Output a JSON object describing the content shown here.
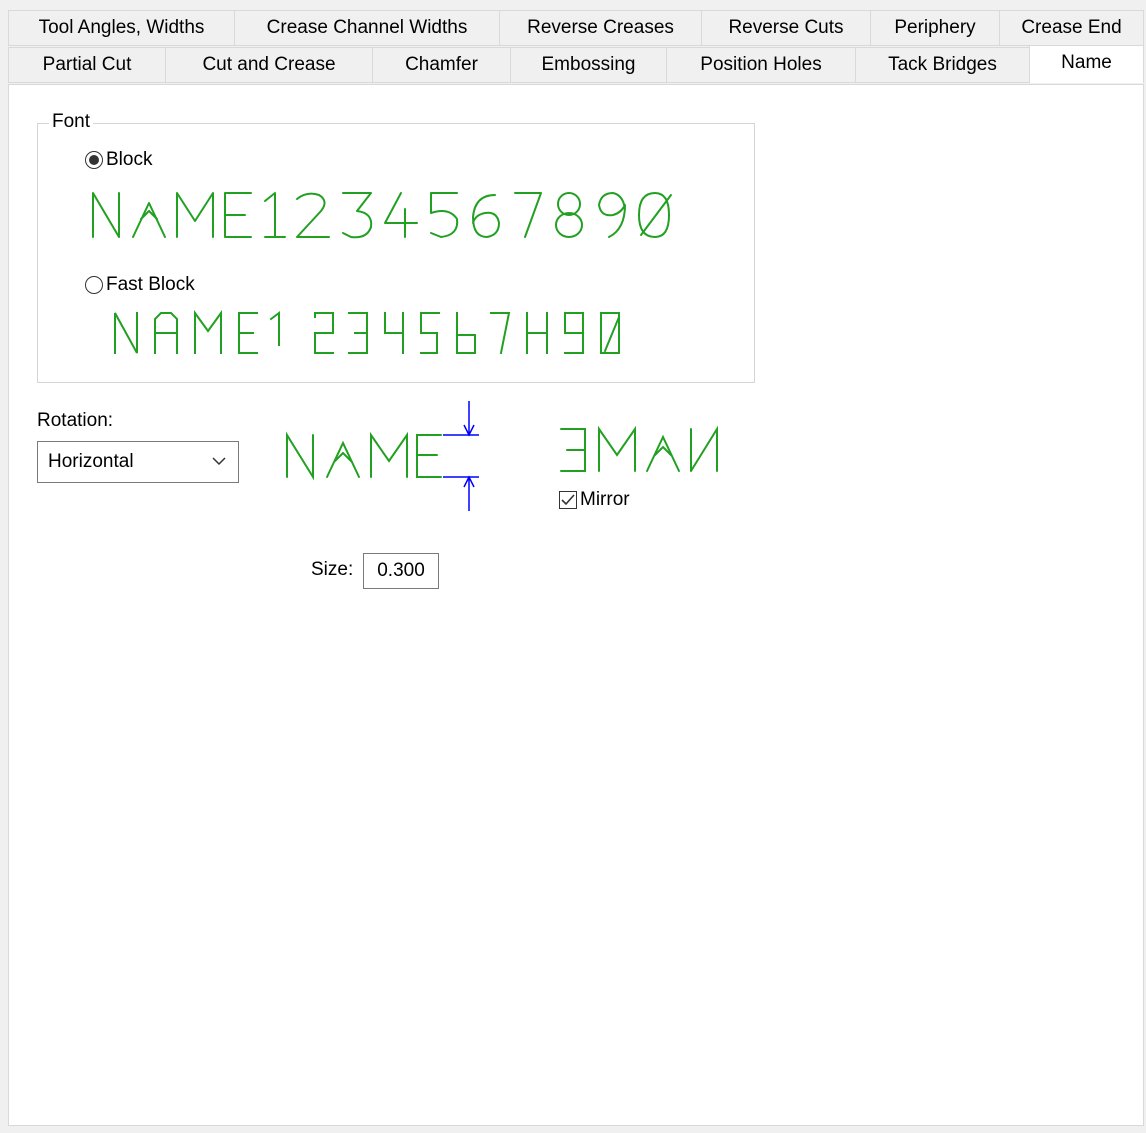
{
  "tabs_row1": [
    "Tool Angles, Widths",
    "Crease Channel Widths",
    "Reverse Creases",
    "Reverse Cuts",
    "Periphery",
    "Crease End"
  ],
  "tabs_row2": [
    "Partial Cut",
    "Cut and Crease",
    "Chamfer",
    "Embossing",
    "Position Holes",
    "Tack Bridges",
    "Name"
  ],
  "active_tab": "Name",
  "font_group": {
    "legend": "Font",
    "block_label": "Block",
    "block_preview": "NAME1234567890",
    "fast_block_label": "Fast Block",
    "fast_block_preview": "NAME1234567890",
    "selected": "Block"
  },
  "rotation": {
    "label": "Rotation:",
    "selected_value": "Horizontal"
  },
  "preview": {
    "sample_text": "NAME",
    "mirror_label": "Mirror",
    "mirror_checked": true
  },
  "size": {
    "label": "Size:",
    "value": "0.300"
  },
  "colors": {
    "glyph_green": "#22a022",
    "dimension_blue": "#0000ff"
  }
}
